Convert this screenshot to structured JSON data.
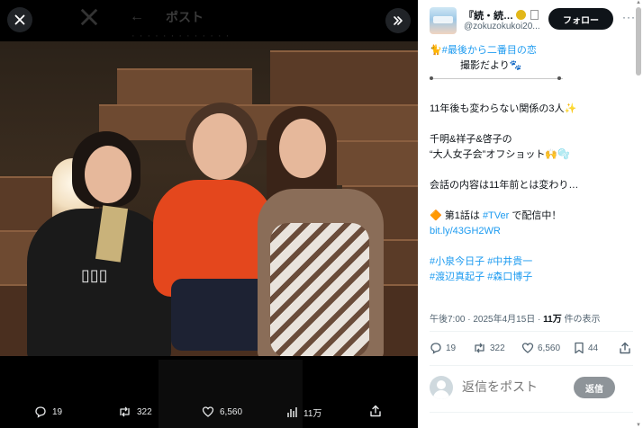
{
  "viewer": {
    "background_title": "ポスト",
    "actions": {
      "replies": "19",
      "reposts": "322",
      "likes": "6,560",
      "views": "11万"
    }
  },
  "post": {
    "author_name": "『続・続…",
    "handle": "@zokuzokukoi20...",
    "follow_label": "フォロー",
    "lines": {
      "l1": "🐈#最後から二番目の恋",
      "l2": "撮影だより🐾",
      "l3": "11年後も変わらない関係の3人✨",
      "l4": "千明&祥子&啓子の",
      "l5": "“大人女子会”オフショット🙌🫧",
      "l6": "会話の内容は11年前とは変わり…",
      "l7_prefix": "🔶 第1話は ",
      "l7_link": "#TVer",
      "l7_suffix": " で配信中！",
      "l8_link": "bit.ly/43GH2WR",
      "tag1": "#小泉今日子",
      "tag2": "#中井貴一",
      "tag3": "#渡辺真起子",
      "tag4": "#森口博子"
    },
    "meta": {
      "time": "午後7:00 · 2025年4月15日 · ",
      "views_count": "11万",
      "views_label": " 件の表示"
    },
    "actions": {
      "replies": "19",
      "reposts": "322",
      "likes": "6,560",
      "bookmarks": "44"
    }
  },
  "reply": {
    "placeholder": "返信をポスト",
    "button_label": "返信"
  },
  "colors": {
    "accent": "#1d9bf0",
    "follow_bg": "#0f1419",
    "reply_btn_bg": "#8e9499"
  }
}
